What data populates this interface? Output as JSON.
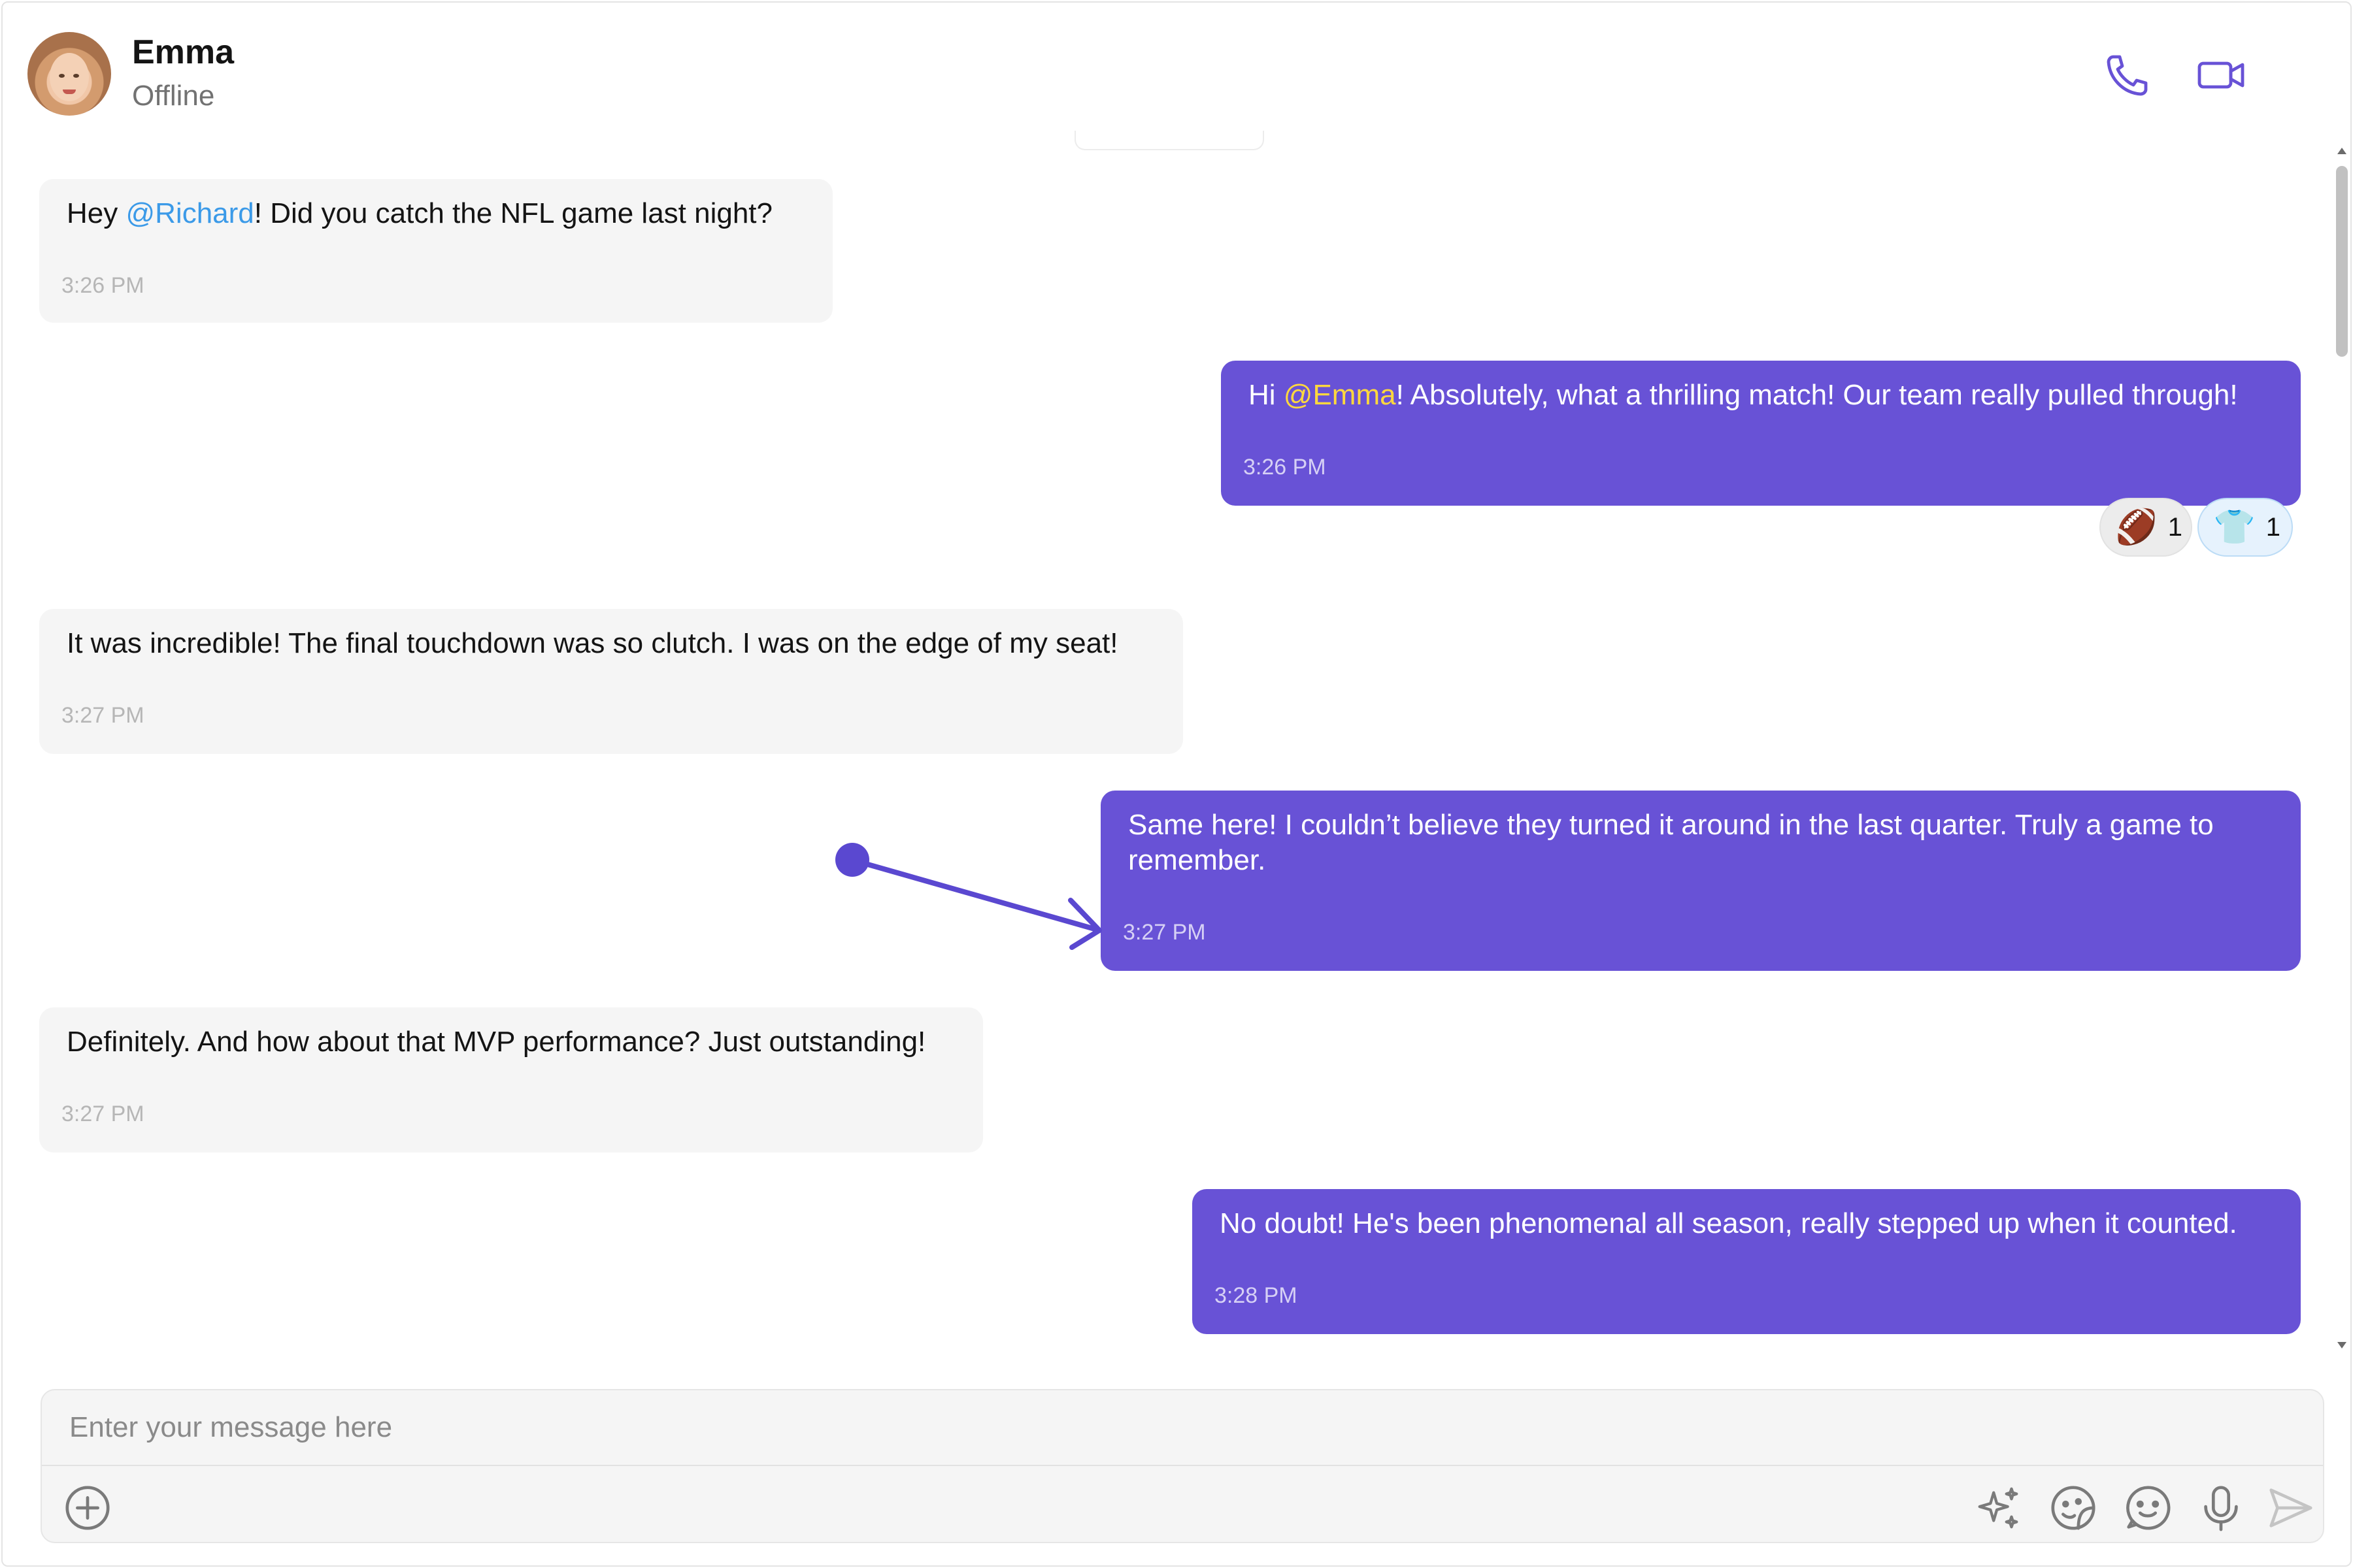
{
  "header": {
    "name": "Emma",
    "status": "Offline",
    "icons": {
      "call": "phone-icon",
      "video": "video-camera-icon"
    }
  },
  "messages": [
    {
      "side": "incoming",
      "parts": [
        "Hey ",
        "@Richard",
        "! Did you catch the NFL game last night?"
      ],
      "time": "3:26 PM"
    },
    {
      "side": "outgoing",
      "parts": [
        "Hi ",
        "@Emma",
        "! Absolutely, what a thrilling match! Our team really pulled through!"
      ],
      "time": "3:26 PM",
      "reactions": [
        {
          "emoji": "🏈",
          "count": "1"
        },
        {
          "emoji": "👕",
          "count": "1"
        }
      ]
    },
    {
      "side": "incoming",
      "text": "It was incredible! The final touchdown was so clutch. I was on the edge of my seat!",
      "time": "3:27 PM"
    },
    {
      "side": "outgoing",
      "text_line1": "Same here! I couldn’t believe they turned it around in the last quarter. Truly a game to",
      "text_line2": "remember.",
      "time": "3:27 PM"
    },
    {
      "side": "incoming",
      "text": "Definitely. And how about that MVP performance? Just outstanding!",
      "time": "3:27 PM"
    },
    {
      "side": "outgoing",
      "text": "No doubt! He's been phenomenal all season, really stepped up when it counted.",
      "time": "3:28 PM"
    }
  ],
  "composer": {
    "placeholder": "Enter your message here",
    "icons": [
      "plus-circle-icon",
      "ai-sparkle-icon",
      "sticker-icon",
      "emoji-icon",
      "microphone-icon",
      "send-icon"
    ]
  },
  "colors": {
    "accent": "#6852d6",
    "incoming_bubble": "#f5f5f5",
    "mention_incoming": "#3b9ae8",
    "mention_outgoing": "#ffd83d"
  }
}
